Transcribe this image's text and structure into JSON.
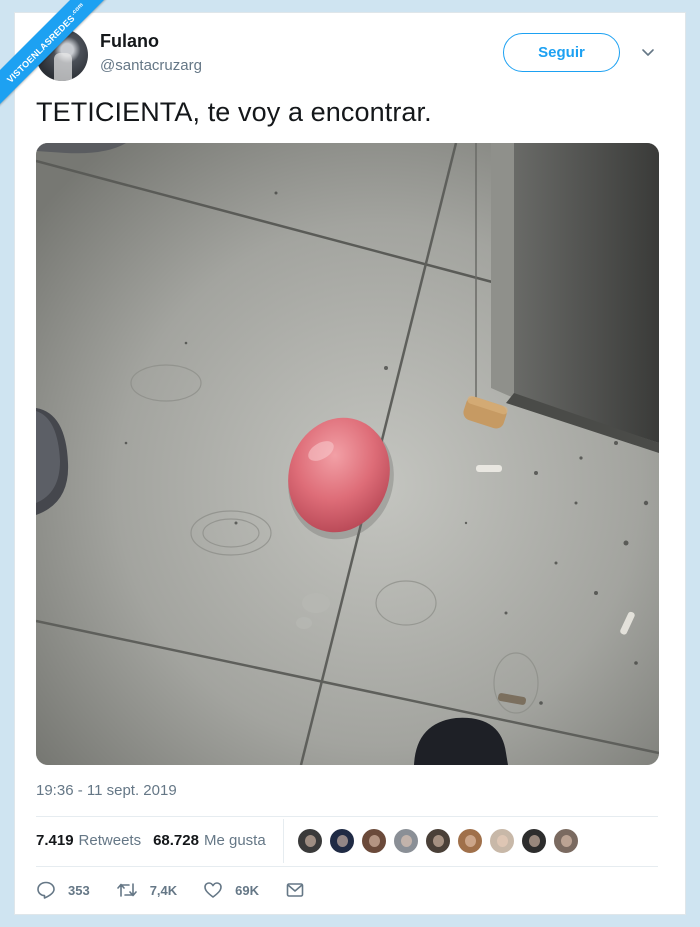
{
  "watermark": {
    "text": "VISTOENLASREDES",
    "suffix": ".com"
  },
  "tweet": {
    "author_name": "Fulano",
    "author_handle": "@santacruzarg",
    "follow_label": "Seguir",
    "text": "TETICIENTA, te voy a encontrar.",
    "timestamp": "19:36 - 11 sept. 2019",
    "retweets_count": "7.419",
    "retweets_label": "Retweets",
    "likes_count": "68.728",
    "likes_label": "Me gusta",
    "replies_short": "353",
    "retweets_short": "7,4K",
    "likes_short": "69K"
  },
  "liker_avatar_colors": [
    "#3a3a3a",
    "#1f2a44",
    "#6b4a3a",
    "#8a8f96",
    "#4a4038",
    "#a0704a",
    "#c8b8a8",
    "#2d2d2d",
    "#7a6a60"
  ],
  "colors": {
    "accent": "#1da1f2",
    "secondary_text": "#657786",
    "background": "#cfe4f1"
  },
  "icons": {
    "more": "chevron-down-icon",
    "reply": "reply-icon",
    "retweet": "retweet-icon",
    "like": "heart-icon",
    "dm": "envelope-icon"
  }
}
